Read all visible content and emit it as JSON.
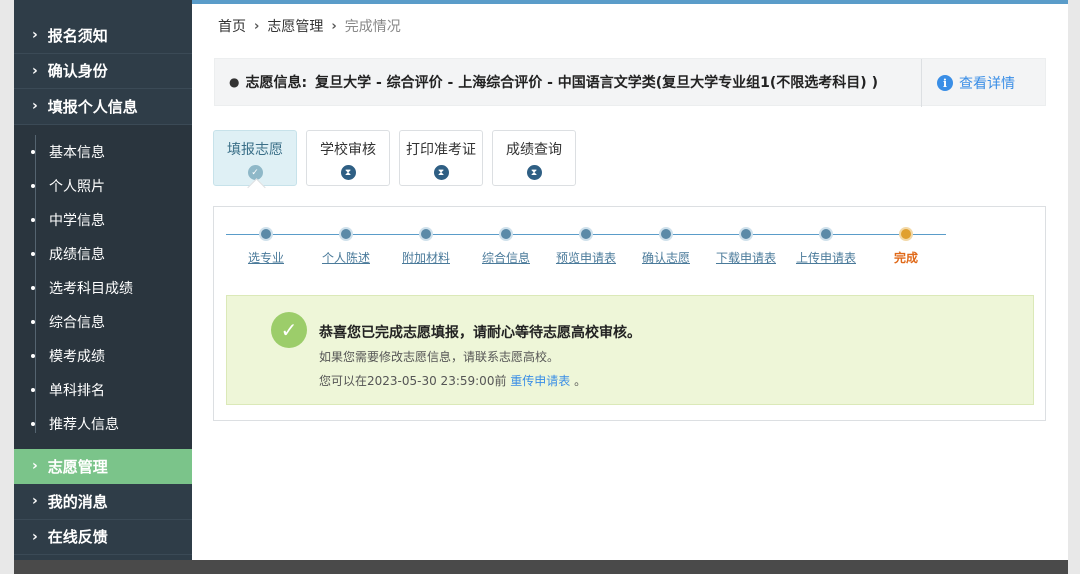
{
  "sidebar": {
    "items": [
      {
        "label": "报名须知"
      },
      {
        "label": "确认身份"
      },
      {
        "label": "填报个人信息"
      }
    ],
    "subitems": [
      {
        "label": "基本信息"
      },
      {
        "label": "个人照片"
      },
      {
        "label": "中学信息"
      },
      {
        "label": "成绩信息"
      },
      {
        "label": "选考科目成绩"
      },
      {
        "label": "综合信息"
      },
      {
        "label": "模考成绩"
      },
      {
        "label": "单科排名"
      },
      {
        "label": "推荐人信息"
      }
    ],
    "bottom_items": [
      {
        "label": "志愿管理",
        "active": true
      },
      {
        "label": "我的消息"
      },
      {
        "label": "在线反馈"
      }
    ]
  },
  "breadcrumb": {
    "home": "首页",
    "section": "志愿管理",
    "current": "完成情况"
  },
  "info": {
    "label": "志愿信息:",
    "value": "复旦大学 - 综合评价 - 上海综合评价 - 中国语言文学类(复旦大学专业组1(不限选考科目) )",
    "detail_link": "查看详情"
  },
  "tabs": [
    {
      "label": "填报志愿",
      "icon": "check-icon",
      "active": true
    },
    {
      "label": "学校审核",
      "icon": "hourglass-icon"
    },
    {
      "label": "打印准考证",
      "icon": "hourglass-icon"
    },
    {
      "label": "成绩查询",
      "icon": "hourglass-icon"
    }
  ],
  "steps": [
    {
      "label": "选专业"
    },
    {
      "label": "个人陈述"
    },
    {
      "label": "附加材料"
    },
    {
      "label": "综合信息"
    },
    {
      "label": "预览申请表"
    },
    {
      "label": "确认志愿"
    },
    {
      "label": "下载申请表"
    },
    {
      "label": "上传申请表"
    },
    {
      "label": "完成",
      "current": true
    }
  ],
  "success": {
    "title": "恭喜您已完成志愿填报，请耐心等待志愿高校审核。",
    "subtitle": "如果您需要修改志愿信息，请联系志愿高校。",
    "deadline_prefix": "您可以在2023-05-30 23:59:00前",
    "deadline_link": "重传申请表",
    "deadline_suffix": "。"
  },
  "colors": {
    "sidebar_bg": "#2f3d48",
    "active_item": "#7bc48a",
    "link": "#3a8ee6",
    "success_bg": "#eef6d8",
    "current_step": "#e06a1a"
  }
}
